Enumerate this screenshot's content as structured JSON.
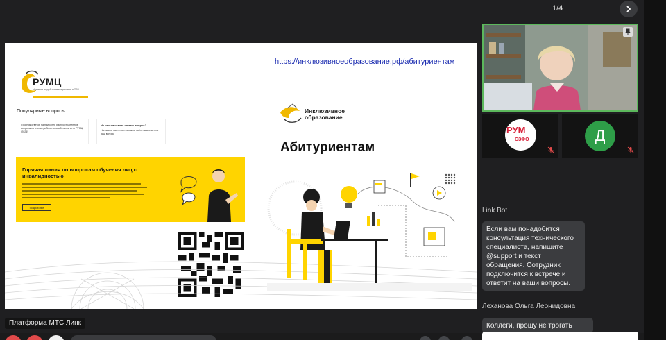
{
  "header": {
    "page_counter": "1/4"
  },
  "slide": {
    "link_text": "https://инклюзивноеобразование.рф/абитуриентам",
    "left_logo": "РУМЦ",
    "left_logo_subtitle": "обучения людей с инвалидностью и ОВЗ",
    "popular_title": "Популярные вопросы",
    "card1_title": "Сборник ответов на наиболее распространенные вопросы по итогам работы горячей линии сети РУМЦ (2024)",
    "card2_title": "Не нашли ответа на ваш вопрос?",
    "card2_text": "Напишите нам и мы поможем найти ваш ответ на ваш вопрос",
    "hotline_title": "Горячая линия по вопросам обучения лиц с инвалидностью",
    "hotline_button": "Подробнее",
    "right_logo_line1": "Инклюзивное",
    "right_logo_line2": "образование",
    "heading": "Абитуриентам"
  },
  "participants": [
    {
      "name": "speaker-video",
      "muted": false
    },
    {
      "name": "РУМ",
      "subtitle": "СЗФО",
      "muted": true
    },
    {
      "name": "Д",
      "muted": true,
      "color": "#2e9e48"
    }
  ],
  "chat": {
    "messages": [
      {
        "sender": "Link Bot",
        "text": "Если вам понадобится консультация технического специалиста, напишите @support и текст обращения. Сотрудник подключится к встрече и ответит на ваши вопросы."
      },
      {
        "sender": "Леханова Ольга Леонидовна",
        "text": "Коллеги, прошу не трогать"
      }
    ]
  },
  "footer": {
    "platform_label": "Платформа МТС Линк"
  },
  "colors": {
    "accent_green": "#5cb85c",
    "slide_yellow": "#ffd400",
    "avatar_green": "#2e9e48",
    "ctrl_red": "#e14a4a"
  }
}
